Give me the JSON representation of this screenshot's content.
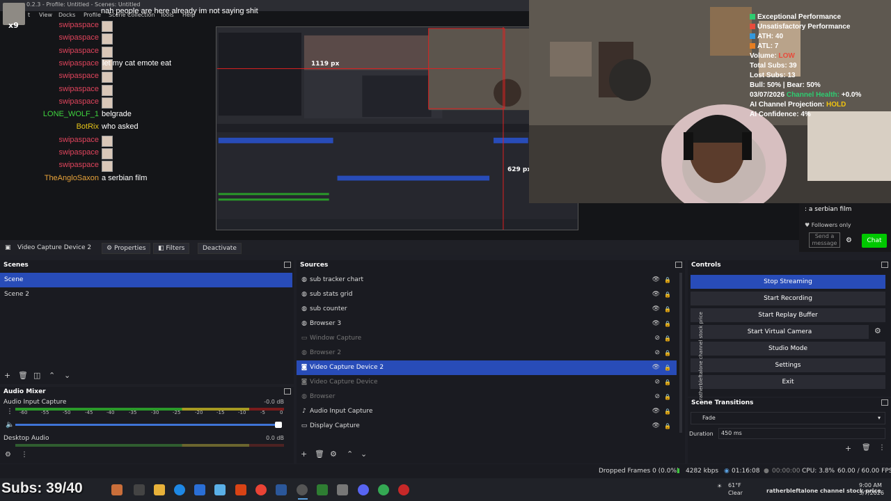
{
  "window": {
    "title": "0.2.3 - Profile: Untitled - Scenes: Untitled"
  },
  "menu": {
    "items": [
      "t",
      "View",
      "Docks",
      "Profile",
      "Scene Collection",
      "Tools",
      "Help"
    ]
  },
  "chat": {
    "top_message": "nah people are here already im not saying shit",
    "badge": "x9",
    "lines": [
      {
        "user": "swipaspace",
        "color": "#e0445c",
        "message": "",
        "emote": true
      },
      {
        "user": "swipaspace",
        "color": "#e0445c",
        "message": "",
        "emote": true
      },
      {
        "user": "swipaspace",
        "color": "#e0445c",
        "message": "",
        "emote": true
      },
      {
        "user": "swipaspace",
        "color": "#e0445c",
        "message": "let my cat emote eat",
        "emote": true
      },
      {
        "user": "swipaspace",
        "color": "#e0445c",
        "message": "",
        "emote": true
      },
      {
        "user": "swipaspace",
        "color": "#e0445c",
        "message": "",
        "emote": true
      },
      {
        "user": "swipaspace",
        "color": "#e0445c",
        "message": "",
        "emote": true
      },
      {
        "user": "LONE_WOLF_1",
        "color": "#3fd43f",
        "message": "belgrade",
        "emote": false
      },
      {
        "user": "BotRix",
        "color": "#e6c419",
        "message": "who asked",
        "emote": false
      },
      {
        "user": "swipaspace",
        "color": "#e0445c",
        "message": "",
        "emote": true
      },
      {
        "user": "swipaspace",
        "color": "#e0445c",
        "message": "",
        "emote": true
      },
      {
        "user": "swipaspace",
        "color": "#e0445c",
        "message": "",
        "emote": true
      },
      {
        "user": "TheAngloSaxon",
        "color": "#e8a33a",
        "message": "a serbian film",
        "emote": false
      }
    ]
  },
  "nested_screen": {
    "label_1": "1119 px",
    "label_2": "629 px"
  },
  "stream_overlay": {
    "lines": [
      {
        "text": "Exceptional Performance",
        "color": "#2ecc71"
      },
      {
        "text": "Unsatisfactory Performance",
        "color": "#e74c3c"
      },
      {
        "text": "ATH: 40",
        "color": "#3498db"
      },
      {
        "text": "ATL: 7",
        "color": "#e67e22"
      }
    ],
    "volume_label": "Volume:",
    "volume_value": "LOW",
    "total_subs": "Total Subs: 39",
    "lost_subs": "Lost Subs: 13",
    "bull_bear": "Bull: 50% | Bear: 50%",
    "date": "03/07/2026",
    "channel_health_label": "Channel Health:",
    "channel_health_value": "+0.0%",
    "projection_label": "AI Channel Projection:",
    "projection_value": "HOLD",
    "confidence": "AI Confidence: 4%"
  },
  "twitch_chat": {
    "last_line": ": a serbian film",
    "followers_only": "Followers only",
    "send_placeholder": "Send a message",
    "chat_button": "Chat"
  },
  "source_toolbar": {
    "selected_source": "Video Capture Device 2",
    "properties": "Properties",
    "filters": "Filters",
    "deactivate": "Deactivate"
  },
  "scenes": {
    "title": "Scenes",
    "items": [
      {
        "name": "Scene",
        "selected": true
      },
      {
        "name": "Scene 2",
        "selected": false
      }
    ]
  },
  "sources": {
    "title": "Sources",
    "items": [
      {
        "name": "sub tracker chart",
        "icon": "browser-icon",
        "visible": true,
        "selected": false
      },
      {
        "name": "sub stats grid",
        "icon": "browser-icon",
        "visible": true,
        "selected": false
      },
      {
        "name": "sub counter",
        "icon": "browser-icon",
        "visible": true,
        "selected": false
      },
      {
        "name": "Browser 3",
        "icon": "browser-icon",
        "visible": true,
        "selected": false
      },
      {
        "name": "Window Capture",
        "icon": "window-icon",
        "visible": false,
        "selected": false
      },
      {
        "name": "Browser 2",
        "icon": "browser-icon",
        "visible": false,
        "selected": false
      },
      {
        "name": "Video Capture Device 2",
        "icon": "camera-icon",
        "visible": true,
        "selected": true
      },
      {
        "name": "Video Capture Device",
        "icon": "camera-icon",
        "visible": false,
        "selected": false
      },
      {
        "name": "Browser",
        "icon": "browser-icon",
        "visible": false,
        "selected": false
      },
      {
        "name": "Audio Input Capture",
        "icon": "mic-icon",
        "visible": true,
        "selected": false
      },
      {
        "name": "Display Capture",
        "icon": "display-icon",
        "visible": true,
        "selected": false
      }
    ]
  },
  "controls": {
    "title": "Controls",
    "buttons": [
      "Stop Streaming",
      "Start Recording",
      "Start Replay Buffer",
      "Start Virtual Camera",
      "Studio Mode",
      "Settings",
      "Exit"
    ]
  },
  "scene_transitions": {
    "title": "Scene Transitions",
    "type": "Fade",
    "duration_label": "Duration",
    "duration_value": "450 ms"
  },
  "audio_mixer": {
    "title": "Audio Mixer",
    "tracks": [
      {
        "name": "Audio Input Capture",
        "db": "-0.0 dB",
        "active": true
      },
      {
        "name": "Desktop Audio",
        "db": "0.0 dB",
        "active": false
      }
    ],
    "scale": [
      "-60",
      "-55",
      "-50",
      "-45",
      "-40",
      "-35",
      "-30",
      "-25",
      "-20",
      "-15",
      "-10",
      "-5",
      "0"
    ]
  },
  "status_bar": {
    "dropped_frames": "Dropped Frames 0 (0.0%)",
    "bitrate": "4282 kbps",
    "stream_time": "01:16:08",
    "rec_time": "00:00:00",
    "cpu": "CPU: 3.8%",
    "fps": "60.00 / 60.00 FPS"
  },
  "taskbar": {
    "subs_overlay": "Subs: 39/40",
    "weather_temp": "61°F",
    "weather_desc": "Clear",
    "ticker": "ratherbleftalone channel stock price",
    "time": "9:00 AM",
    "date": "3/7/2026"
  }
}
